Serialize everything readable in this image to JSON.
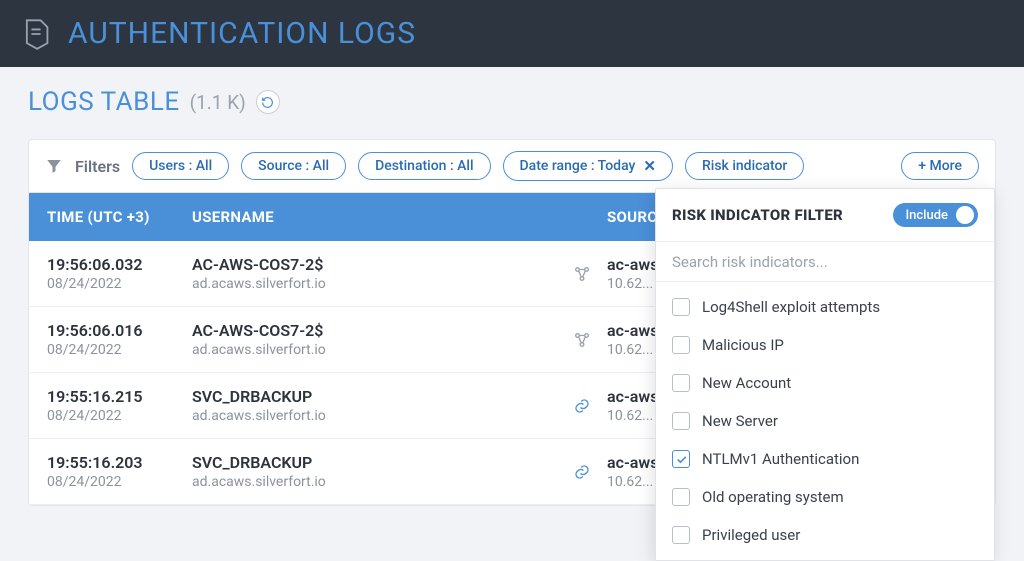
{
  "header": {
    "title": "AUTHENTICATION LOGS"
  },
  "section": {
    "title": "LOGS TABLE",
    "count": "(1.1 K)"
  },
  "filters": {
    "label": "Filters",
    "chips": {
      "users": "Users : All",
      "source": "Source : All",
      "destination": "Destination : All",
      "date_range": "Date range : Today",
      "risk": "Risk indicator",
      "more": "+ More"
    }
  },
  "columns": {
    "time": "TIME (UTC +3)",
    "username": "USERNAME",
    "source": "SOURCE"
  },
  "rows": [
    {
      "time": "19:56:06.032",
      "date": "08/24/2022",
      "username": "AC-AWS-COS7-2$",
      "domain": "ad.acaws.silverfort.io",
      "icon": "nodes",
      "source_host": "ac-aws...",
      "source_ip": "10.62..."
    },
    {
      "time": "19:56:06.016",
      "date": "08/24/2022",
      "username": "AC-AWS-COS7-2$",
      "domain": "ad.acaws.silverfort.io",
      "icon": "nodes",
      "source_host": "ac-aws...",
      "source_ip": "10.62..."
    },
    {
      "time": "19:55:16.215",
      "date": "08/24/2022",
      "username": "SVC_DRBACKUP",
      "domain": "ad.acaws.silverfort.io",
      "icon": "link",
      "source_host": "ac-aws...",
      "source_ip": "10.62..."
    },
    {
      "time": "19:55:16.203",
      "date": "08/24/2022",
      "username": "SVC_DRBACKUP",
      "domain": "ad.acaws.silverfort.io",
      "icon": "link",
      "source_host": "ac-aws...",
      "source_ip": "10.62..."
    }
  ],
  "popover": {
    "title": "RISK INDICATOR FILTER",
    "toggle_label": "Include",
    "search_placeholder": "Search risk indicators...",
    "options": [
      {
        "label": "Log4Shell exploit attempts",
        "checked": false
      },
      {
        "label": "Malicious IP",
        "checked": false
      },
      {
        "label": "New Account",
        "checked": false
      },
      {
        "label": "New Server",
        "checked": false
      },
      {
        "label": "NTLMv1 Authentication",
        "checked": true
      },
      {
        "label": "Old operating system",
        "checked": false
      },
      {
        "label": "Privileged user",
        "checked": false
      }
    ]
  }
}
